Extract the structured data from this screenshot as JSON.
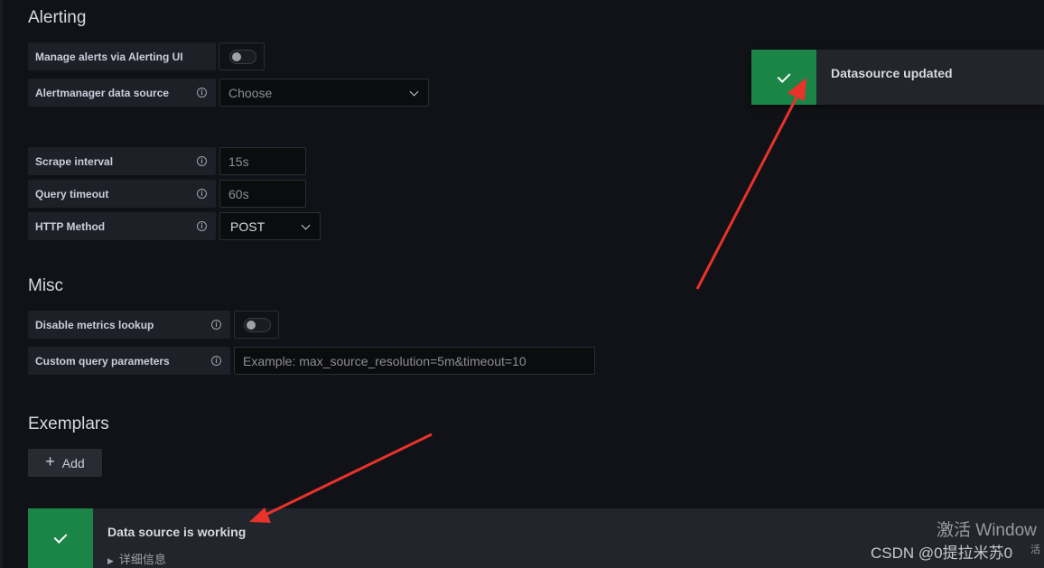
{
  "alerting": {
    "title": "Alerting",
    "manage_label": "Manage alerts via Alerting UI",
    "alertmanager_label": "Alertmanager data source",
    "alertmanager_placeholder": "Choose"
  },
  "http": {
    "scrape_label": "Scrape interval",
    "scrape_placeholder": "15s",
    "timeout_label": "Query timeout",
    "timeout_placeholder": "60s",
    "method_label": "HTTP Method",
    "method_value": "POST"
  },
  "misc": {
    "title": "Misc",
    "disable_metrics_label": "Disable metrics lookup",
    "custom_params_label": "Custom query parameters",
    "custom_params_placeholder": "Example: max_source_resolution=5m&timeout=10"
  },
  "exemplars": {
    "title": "Exemplars",
    "add_label": "Add"
  },
  "status": {
    "message": "Data source is working",
    "details_label": "详细信息"
  },
  "toast": {
    "message": "Datasource updated"
  },
  "watermark": {
    "windows": "激活 Window",
    "windows_sub": "活",
    "csdn": "CSDN @0提拉米苏0"
  },
  "colors": {
    "success": "#1b8547",
    "annotation_arrow": "#e8322a",
    "background": "#111217"
  }
}
